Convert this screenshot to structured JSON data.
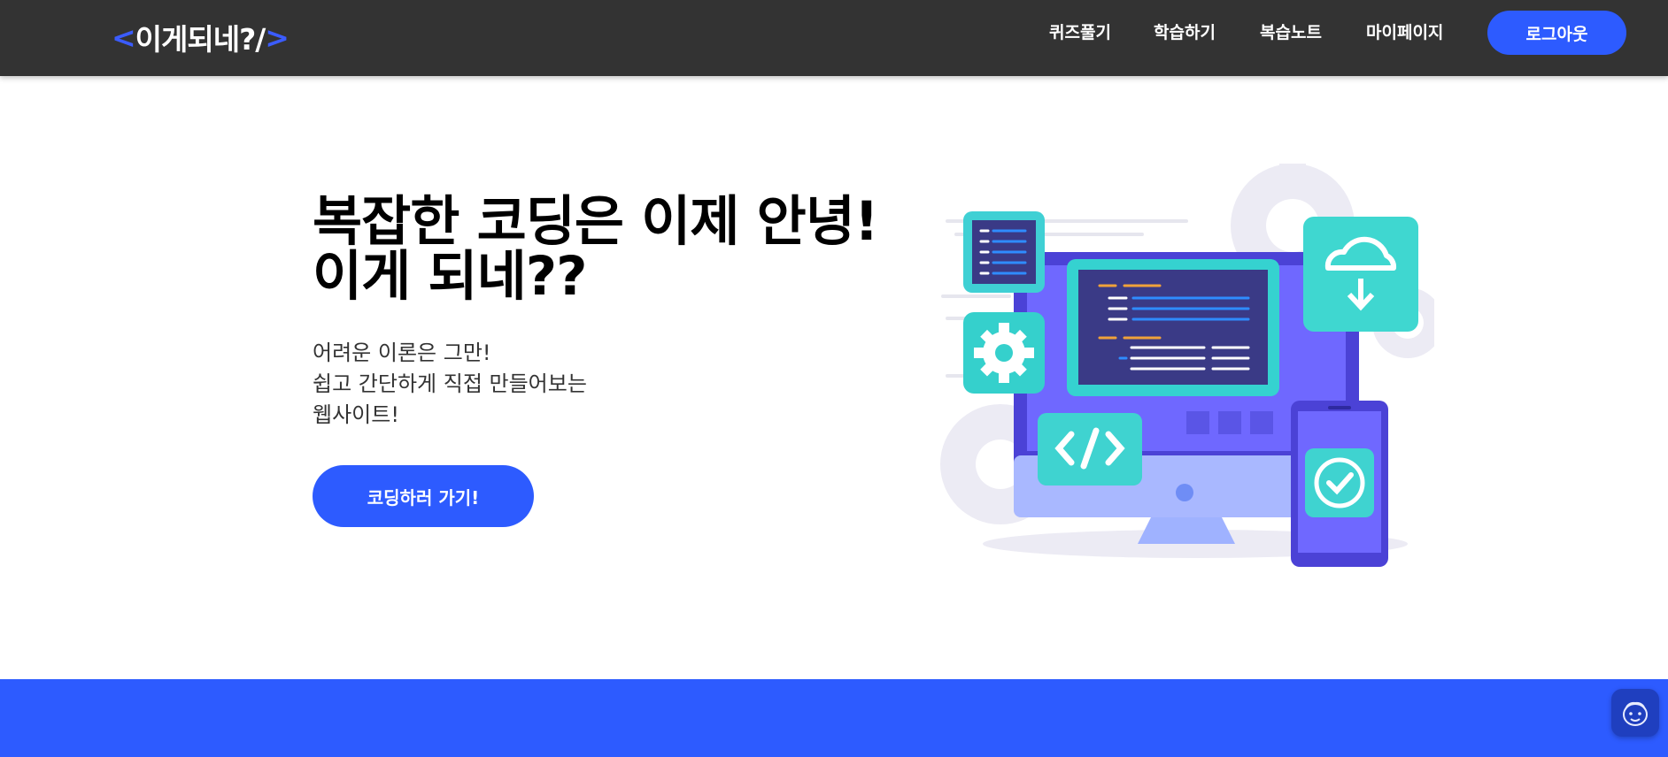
{
  "header": {
    "logo": {
      "open": "<",
      "word": "이게되네?/",
      "close": ">"
    },
    "nav": [
      {
        "label": "퀴즈풀기"
      },
      {
        "label": "학습하기"
      },
      {
        "label": "복습노트"
      },
      {
        "label": "마이페이지"
      }
    ],
    "logout_label": "로그아웃"
  },
  "hero": {
    "title_lines": [
      "복잡한 코딩은 이제 안녕!",
      "이게 되네??"
    ],
    "subtitle_lines": [
      "어려운 이론은 그만!",
      "쉽고 간단하게 직접 만들어보는",
      "웹사이트!"
    ],
    "cta_label": "코딩하러 가기!"
  },
  "colors": {
    "accent": "#2d5bff",
    "header_bg": "#333333",
    "band": "#2d5bff"
  },
  "icons": {
    "illustration": "developer-computer-illustration",
    "chat": "chatbot-face-icon"
  }
}
